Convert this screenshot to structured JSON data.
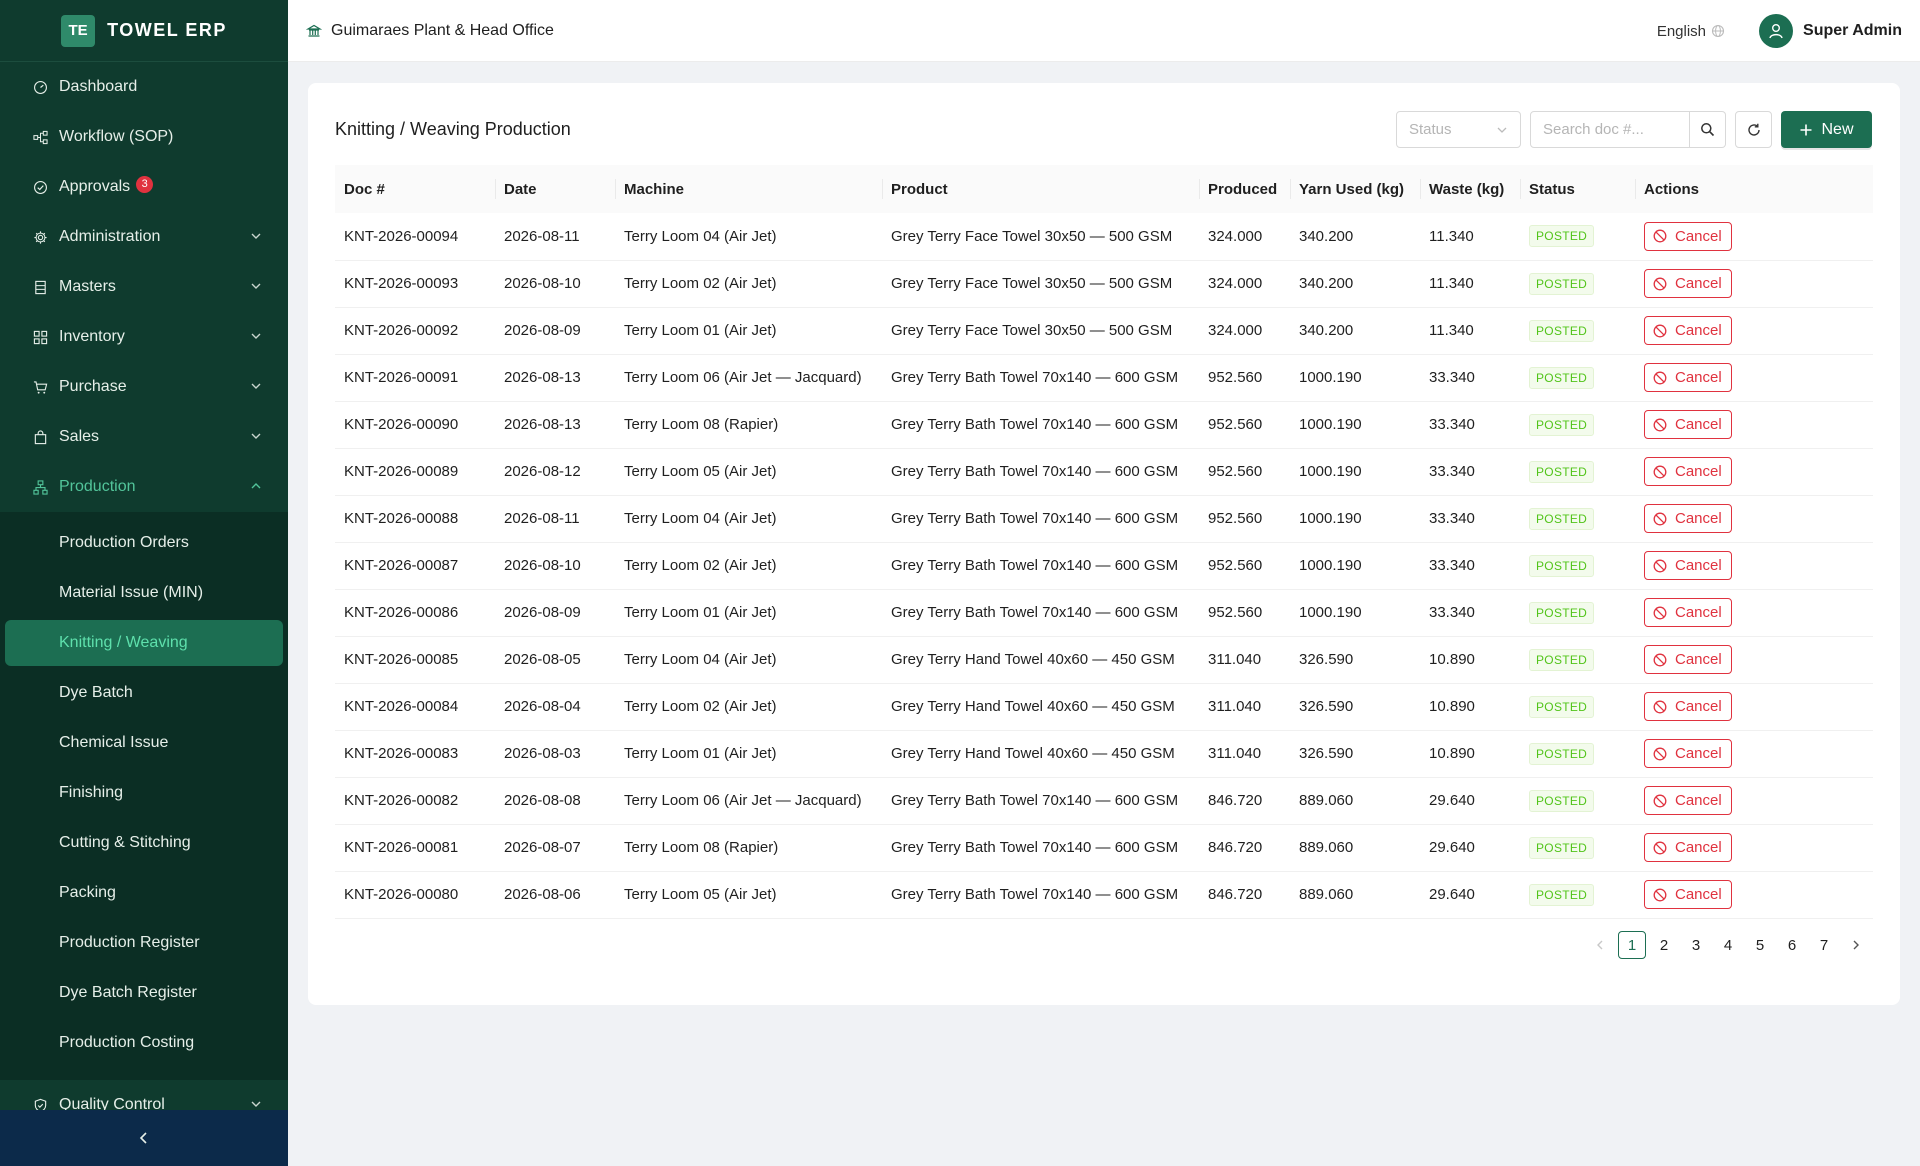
{
  "brand": {
    "logo": "TE",
    "name": "TOWEL ERP"
  },
  "sidebar": {
    "items": [
      {
        "label": "Dashboard",
        "icon": "dashboard-icon",
        "has_chevron": false
      },
      {
        "label": "Workflow (SOP)",
        "icon": "workflow-icon",
        "has_chevron": false
      },
      {
        "label": "Approvals",
        "icon": "check-circle-icon",
        "badge": "3",
        "has_chevron": false
      },
      {
        "label": "Administration",
        "icon": "gear-icon",
        "has_chevron": true
      },
      {
        "label": "Masters",
        "icon": "database-icon",
        "has_chevron": true
      },
      {
        "label": "Inventory",
        "icon": "grid-icon",
        "has_chevron": true
      },
      {
        "label": "Purchase",
        "icon": "cart-icon",
        "has_chevron": true
      },
      {
        "label": "Sales",
        "icon": "bag-icon",
        "has_chevron": true
      },
      {
        "label": "Production",
        "icon": "org-chart-icon",
        "has_chevron": true,
        "expanded": true
      }
    ],
    "production_sub": [
      "Production Orders",
      "Material Issue (MIN)",
      "Knitting / Weaving",
      "Dye Batch",
      "Chemical Issue",
      "Finishing",
      "Cutting & Stitching",
      "Packing",
      "Production Register",
      "Dye Batch Register",
      "Production Costing"
    ],
    "active_sub": "Knitting / Weaving",
    "after_items": [
      {
        "label": "Quality Control",
        "icon": "shield-check-icon",
        "has_chevron": true
      }
    ]
  },
  "header": {
    "org_name": "Guimaraes Plant & Head Office",
    "language": "English",
    "user_name": "Super Admin"
  },
  "page": {
    "title": "Knitting / Weaving Production",
    "status_placeholder": "Status",
    "search_placeholder": "Search doc #...",
    "new_label": "New"
  },
  "table": {
    "columns": [
      "Doc #",
      "Date",
      "Machine",
      "Product",
      "Produced",
      "Yarn Used (kg)",
      "Waste (kg)",
      "Status",
      "Actions"
    ],
    "rows": [
      {
        "doc": "KNT-2026-00094",
        "date": "2026-08-11",
        "machine": "Terry Loom 04 (Air Jet)",
        "product": "Grey Terry Face Towel 30x50 — 500 GSM",
        "produced": "324.000",
        "yarn": "340.200",
        "waste": "11.340",
        "status": "POSTED",
        "action": "Cancel"
      },
      {
        "doc": "KNT-2026-00093",
        "date": "2026-08-10",
        "machine": "Terry Loom 02 (Air Jet)",
        "product": "Grey Terry Face Towel 30x50 — 500 GSM",
        "produced": "324.000",
        "yarn": "340.200",
        "waste": "11.340",
        "status": "POSTED",
        "action": "Cancel"
      },
      {
        "doc": "KNT-2026-00092",
        "date": "2026-08-09",
        "machine": "Terry Loom 01 (Air Jet)",
        "product": "Grey Terry Face Towel 30x50 — 500 GSM",
        "produced": "324.000",
        "yarn": "340.200",
        "waste": "11.340",
        "status": "POSTED",
        "action": "Cancel"
      },
      {
        "doc": "KNT-2026-00091",
        "date": "2026-08-13",
        "machine": "Terry Loom 06 (Air Jet — Jacquard)",
        "product": "Grey Terry Bath Towel 70x140 — 600 GSM",
        "produced": "952.560",
        "yarn": "1000.190",
        "waste": "33.340",
        "status": "POSTED",
        "action": "Cancel"
      },
      {
        "doc": "KNT-2026-00090",
        "date": "2026-08-13",
        "machine": "Terry Loom 08 (Rapier)",
        "product": "Grey Terry Bath Towel 70x140 — 600 GSM",
        "produced": "952.560",
        "yarn": "1000.190",
        "waste": "33.340",
        "status": "POSTED",
        "action": "Cancel"
      },
      {
        "doc": "KNT-2026-00089",
        "date": "2026-08-12",
        "machine": "Terry Loom 05 (Air Jet)",
        "product": "Grey Terry Bath Towel 70x140 — 600 GSM",
        "produced": "952.560",
        "yarn": "1000.190",
        "waste": "33.340",
        "status": "POSTED",
        "action": "Cancel"
      },
      {
        "doc": "KNT-2026-00088",
        "date": "2026-08-11",
        "machine": "Terry Loom 04 (Air Jet)",
        "product": "Grey Terry Bath Towel 70x140 — 600 GSM",
        "produced": "952.560",
        "yarn": "1000.190",
        "waste": "33.340",
        "status": "POSTED",
        "action": "Cancel"
      },
      {
        "doc": "KNT-2026-00087",
        "date": "2026-08-10",
        "machine": "Terry Loom 02 (Air Jet)",
        "product": "Grey Terry Bath Towel 70x140 — 600 GSM",
        "produced": "952.560",
        "yarn": "1000.190",
        "waste": "33.340",
        "status": "POSTED",
        "action": "Cancel"
      },
      {
        "doc": "KNT-2026-00086",
        "date": "2026-08-09",
        "machine": "Terry Loom 01 (Air Jet)",
        "product": "Grey Terry Bath Towel 70x140 — 600 GSM",
        "produced": "952.560",
        "yarn": "1000.190",
        "waste": "33.340",
        "status": "POSTED",
        "action": "Cancel"
      },
      {
        "doc": "KNT-2026-00085",
        "date": "2026-08-05",
        "machine": "Terry Loom 04 (Air Jet)",
        "product": "Grey Terry Hand Towel 40x60 — 450 GSM",
        "produced": "311.040",
        "yarn": "326.590",
        "waste": "10.890",
        "status": "POSTED",
        "action": "Cancel"
      },
      {
        "doc": "KNT-2026-00084",
        "date": "2026-08-04",
        "machine": "Terry Loom 02 (Air Jet)",
        "product": "Grey Terry Hand Towel 40x60 — 450 GSM",
        "produced": "311.040",
        "yarn": "326.590",
        "waste": "10.890",
        "status": "POSTED",
        "action": "Cancel"
      },
      {
        "doc": "KNT-2026-00083",
        "date": "2026-08-03",
        "machine": "Terry Loom 01 (Air Jet)",
        "product": "Grey Terry Hand Towel 40x60 — 450 GSM",
        "produced": "311.040",
        "yarn": "326.590",
        "waste": "10.890",
        "status": "POSTED",
        "action": "Cancel"
      },
      {
        "doc": "KNT-2026-00082",
        "date": "2026-08-08",
        "machine": "Terry Loom 06 (Air Jet — Jacquard)",
        "product": "Grey Terry Bath Towel 70x140 — 600 GSM",
        "produced": "846.720",
        "yarn": "889.060",
        "waste": "29.640",
        "status": "POSTED",
        "action": "Cancel"
      },
      {
        "doc": "KNT-2026-00081",
        "date": "2026-08-07",
        "machine": "Terry Loom 08 (Rapier)",
        "product": "Grey Terry Bath Towel 70x140 — 600 GSM",
        "produced": "846.720",
        "yarn": "889.060",
        "waste": "29.640",
        "status": "POSTED",
        "action": "Cancel"
      },
      {
        "doc": "KNT-2026-00080",
        "date": "2026-08-06",
        "machine": "Terry Loom 05 (Air Jet)",
        "product": "Grey Terry Bath Towel 70x140 — 600 GSM",
        "produced": "846.720",
        "yarn": "889.060",
        "waste": "29.640",
        "status": "POSTED",
        "action": "Cancel"
      }
    ]
  },
  "pagination": {
    "pages": [
      "1",
      "2",
      "3",
      "4",
      "5",
      "6",
      "7"
    ],
    "current": "1"
  },
  "colors": {
    "sidebar_bg": "#0f3b2e",
    "accent": "#1c6e52",
    "active_text": "#5ee0ac",
    "danger": "#e0323f",
    "success": "#52c41a"
  }
}
